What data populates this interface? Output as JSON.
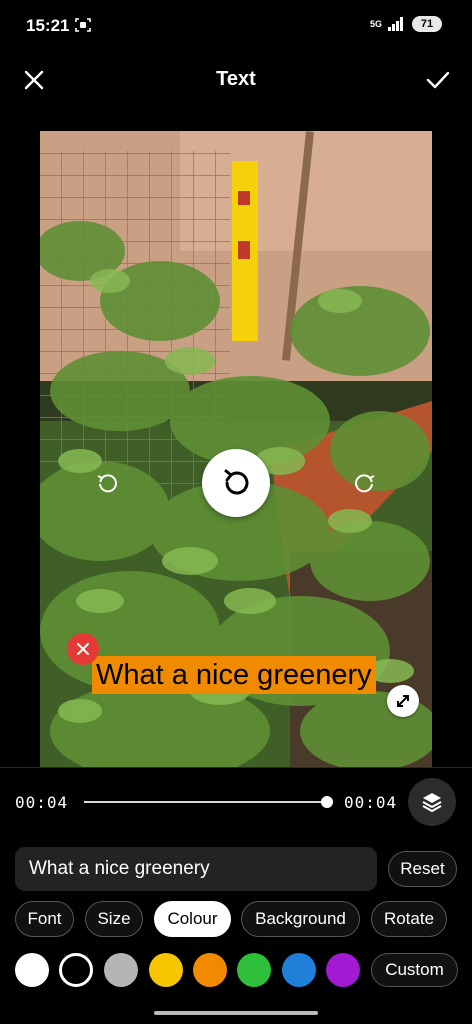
{
  "status_bar": {
    "time": "15:21",
    "network": "5G",
    "battery": "71",
    "icons": [
      "screen-record-icon",
      "signal-icon",
      "battery-icon"
    ]
  },
  "header": {
    "title": "Text",
    "close_icon": "close-icon",
    "confirm_icon": "checkmark-icon"
  },
  "preview": {
    "overlay_text": "What a nice greenery",
    "overlay_background_color": "#f08a00",
    "overlay_text_color": "#000000",
    "controls": [
      "rotate-back-icon",
      "rotate-icon",
      "rotate-forward-icon",
      "delete-icon",
      "resize-icon"
    ]
  },
  "timeline": {
    "start_time": "00:04",
    "end_time": "00:04",
    "progress": 0.97,
    "layers_icon": "layers-icon"
  },
  "editor": {
    "input_value": "What a nice greenery",
    "reset_label": "Reset"
  },
  "tabs": [
    {
      "label": "Font",
      "active": false
    },
    {
      "label": "Size",
      "active": false
    },
    {
      "label": "Colour",
      "active": true
    },
    {
      "label": "Background",
      "active": false
    },
    {
      "label": "Rotate",
      "active": false
    }
  ],
  "colors": [
    {
      "name": "white",
      "hex": "#ffffff",
      "selected": false
    },
    {
      "name": "black",
      "hex": "#000000",
      "selected": true
    },
    {
      "name": "grey",
      "hex": "#b5b5b5",
      "selected": false
    },
    {
      "name": "yellow",
      "hex": "#f7c600",
      "selected": false
    },
    {
      "name": "orange",
      "hex": "#f28a00",
      "selected": false
    },
    {
      "name": "green",
      "hex": "#2fbf3a",
      "selected": false
    },
    {
      "name": "blue",
      "hex": "#1f7fd9",
      "selected": false
    },
    {
      "name": "purple",
      "hex": "#a21ad1",
      "selected": false
    }
  ],
  "custom_label": "Custom"
}
